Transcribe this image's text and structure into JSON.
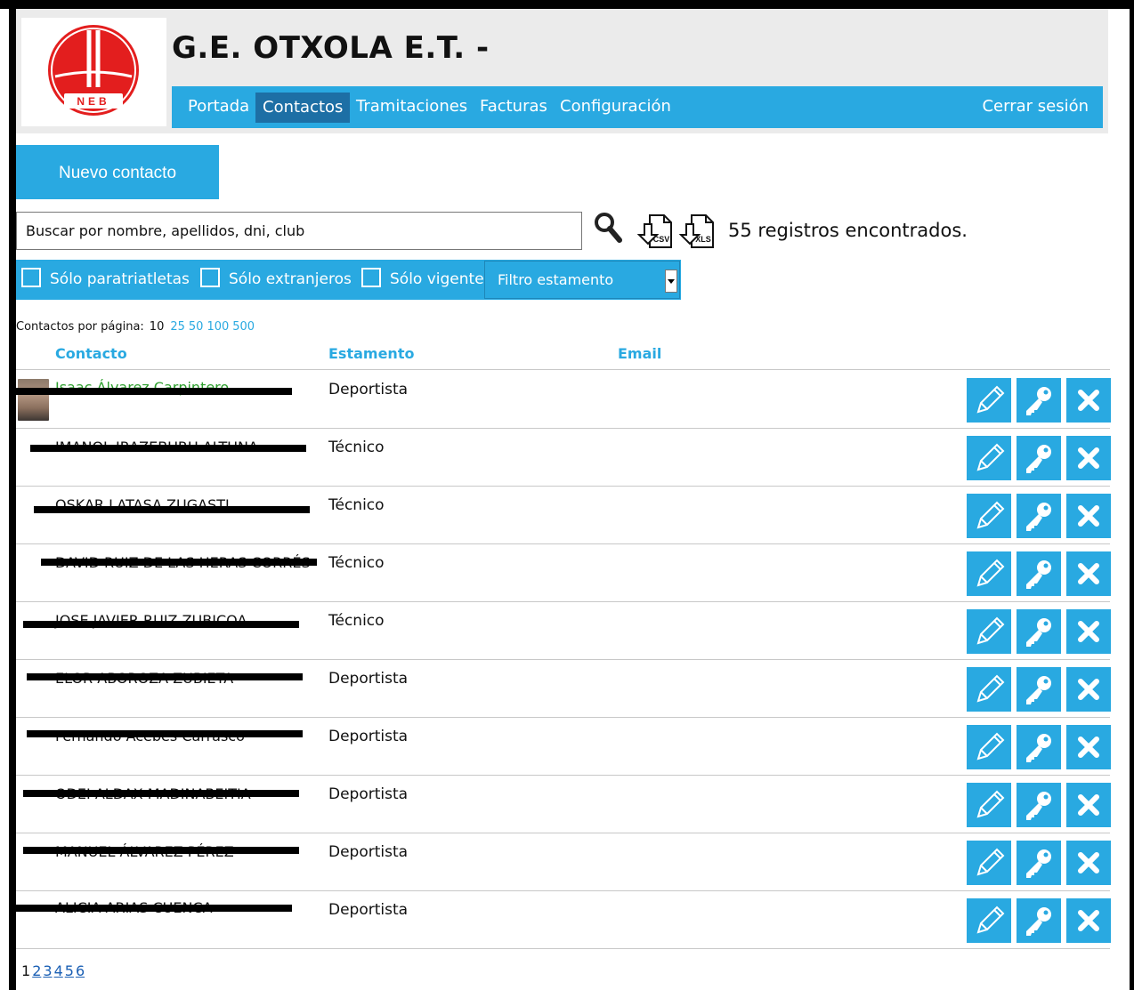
{
  "header": {
    "site_title": "G.E. OTXOLA E.T. -",
    "logo_text": "NEB"
  },
  "nav": {
    "items": [
      {
        "label": "Portada",
        "active": false
      },
      {
        "label": "Contactos",
        "active": true
      },
      {
        "label": "Tramitaciones",
        "active": false
      },
      {
        "label": "Facturas",
        "active": false
      },
      {
        "label": "Configuración",
        "active": false
      }
    ],
    "logout_label": "Cerrar sesión"
  },
  "toolbar": {
    "new_contact_label": "Nuevo contacto",
    "search_placeholder": "Buscar por nombre, apellidos, dni, club",
    "records_text": "55 registros encontrados.",
    "search_icon": "magnifier-icon",
    "csv_icon": "csv-download-icon",
    "xls_icon": "xls-download-icon",
    "csv_label": "CSV",
    "xls_label": "XLS"
  },
  "filters": {
    "paratriatletas_label": "Sólo paratriatletas",
    "extranjeros_label": "Sólo extranjeros",
    "vigentes_label": "Sólo vigentes",
    "estamento_placeholder": "Filtro estamento"
  },
  "per_page": {
    "label": "Contactos por página:",
    "current": "10",
    "options": [
      "25",
      "50",
      "100",
      "500"
    ]
  },
  "table": {
    "headers": {
      "contacto": "Contacto",
      "estamento": "Estamento",
      "email": "Email"
    },
    "rows": [
      {
        "name": "Isaac Álvarez Carpintero",
        "estamento": "Deportista"
      },
      {
        "name": "IMANOL IRAZEBURU ALTUNA",
        "estamento": "Técnico"
      },
      {
        "name": "OSKAR LATASA ZUGASTI",
        "estamento": "Técnico"
      },
      {
        "name": "DAVID RUIZ DE LAS HERAS CORRÉS",
        "estamento": "Técnico"
      },
      {
        "name": "JOSE JAVIER RUIZ ZUBICOA",
        "estamento": "Técnico"
      },
      {
        "name": "ELOR ABOROZA ZUBIETA",
        "estamento": "Deportista"
      },
      {
        "name": "Fernando Acebes Carrasco",
        "estamento": "Deportista"
      },
      {
        "name": "ODEI ALDAX MADINABEITIA",
        "estamento": "Deportista"
      },
      {
        "name": "MANUEL ÁLVAREZ PÉREZ",
        "estamento": "Deportista"
      },
      {
        "name": "ALICIA ARIAS CUENCA",
        "estamento": "Deportista"
      }
    ],
    "row_action_icons": [
      "pencil-icon",
      "key-icon",
      "close-icon"
    ]
  },
  "pagination": {
    "current": "1",
    "pages": [
      "2",
      "3",
      "4",
      "5",
      "6"
    ]
  },
  "colors": {
    "accent": "#29a9e1",
    "nav_active": "#1d6fa5",
    "header_bg": "#ebebeb",
    "logo_red": "#e31e1e",
    "first_contact_green": "#2e9f2e"
  }
}
